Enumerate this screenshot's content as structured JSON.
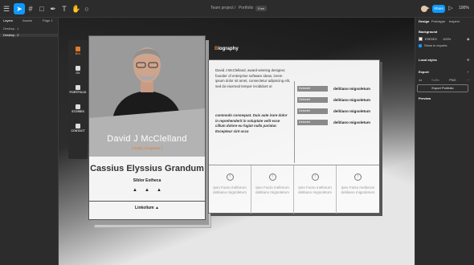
{
  "toolbar": {
    "team": "Team project",
    "sep": "/",
    "file": "Portfolio",
    "badge": "Free",
    "share": "Share",
    "zoom": "100%"
  },
  "left_panel": {
    "tabs": [
      "Layers",
      "Assets"
    ],
    "page": "Page 1",
    "rows": [
      "Desktop - 1",
      "Desktop - 2"
    ]
  },
  "right_panel": {
    "tabs": [
      "Design",
      "Prototype",
      "Inspect"
    ],
    "background_label": "Background",
    "bg_hex": "E5E5E5",
    "bg_opacity": "100%",
    "show_exports": "Show in exports",
    "local_styles": "Local styles",
    "export_label": "Export",
    "export_scale": "1x",
    "export_suffix": "Suffix",
    "export_format": "PNG",
    "export_btn": "Export Portfolio",
    "preview": "Preview"
  },
  "nav": [
    {
      "icon": "user-icon",
      "label": "BIO"
    },
    {
      "icon": "cv-icon",
      "label": "CV"
    },
    {
      "icon": "portfolio-icon",
      "label": "PORTFOLIO"
    },
    {
      "icon": "stories-icon",
      "label": "STORIES"
    },
    {
      "icon": "contact-icon",
      "label": "CONTACT"
    }
  ],
  "card": {
    "name1": "David J McClelland",
    "role1": "[ Entity | Engineer ]",
    "name2": "Cassius Elyssius Grandum",
    "role2": "Siblor Estheca",
    "footer": "Linkolium"
  },
  "content": {
    "bio_prefix": "B",
    "bio_rest": "iography",
    "para1": "David J McClelland, award-winning designer, founder of enterprise software ideas, lorem ipsum dolor sit amet, consectetur adipiscing elit, sed do eiusmod tempor incididunt ut",
    "para2": "commodo consequat. Duis aute irure dolor in reprehenderit in voluptate velit esse cillum dolore eu fugiat nulla pariatur. Excepteur sint occa",
    "rows": [
      {
        "label": "Delectet",
        "value": "delitiano migsoletum"
      },
      {
        "label": "Delectet",
        "value": "delitiano migsoletum"
      },
      {
        "label": "Delectet",
        "value": "delitiano migsoletum"
      },
      {
        "label": "Delectet",
        "value": "delitiano migsoletum"
      }
    ],
    "cells": [
      "Ipso Facto mellorum delitiano migsoletum",
      "Ipso Facto mellorum delitiano migsoletum",
      "Ipso Facto mellorum delitiano migsoletum",
      "Ipso Facto mellorum delitiano migsoletum"
    ]
  }
}
